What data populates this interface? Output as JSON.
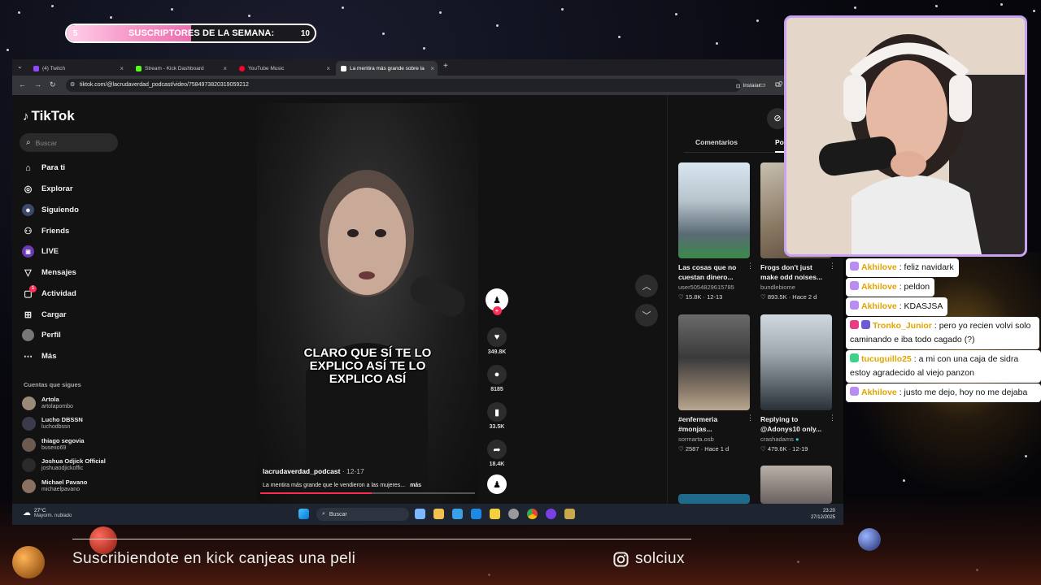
{
  "overlay": {
    "sub_goal": {
      "current": "5",
      "label": "SUSCRIPTORES DE LA SEMANA:",
      "target": "10",
      "progress": 0.5,
      "fill_color": "#f58fc3"
    },
    "footer_text": "Suscribiendote en kick canjeas una peli",
    "instagram_handle": "solciux"
  },
  "browser": {
    "tabs": [
      {
        "label": "(4) Twitch",
        "icon": "twitch-icon",
        "color": "#9146ff"
      },
      {
        "label": "Stream - Kick Dashboard",
        "icon": "kick-icon",
        "color": "#53fc18"
      },
      {
        "label": "YouTube Music",
        "icon": "youtube-music-icon",
        "color": "#ff0033"
      },
      {
        "label": "La mentira más grande sobre la",
        "icon": "tiktok-icon",
        "color": "#ffffff",
        "active": true
      }
    ],
    "url": "tiktok.com/@lacrudaverdad_podcast/video/7584973820319059212",
    "install_label": "Instalar"
  },
  "tiktok": {
    "logo": "TikTok",
    "search_placeholder": "Buscar",
    "nav": [
      {
        "label": "Para ti",
        "icon": "home-icon"
      },
      {
        "label": "Explorar",
        "icon": "compass-icon"
      },
      {
        "label": "Siguiendo",
        "icon": "following-icon"
      },
      {
        "label": "Friends",
        "icon": "friends-icon"
      },
      {
        "label": "LIVE",
        "icon": "live-icon"
      },
      {
        "label": "Mensajes",
        "icon": "messages-icon"
      },
      {
        "label": "Actividad",
        "icon": "activity-icon",
        "badge": "1"
      },
      {
        "label": "Cargar",
        "icon": "upload-icon"
      },
      {
        "label": "Perfil",
        "icon": "profile-icon"
      },
      {
        "label": "Más",
        "icon": "more-icon"
      }
    ],
    "following_heading": "Cuentas que sigues",
    "following": [
      {
        "name": "Artola",
        "handle": "artolapombo"
      },
      {
        "name": "Lucho DBSSN",
        "handle": "luchodbssn"
      },
      {
        "name": "thiago segovia",
        "handle": "busexo69"
      },
      {
        "name": "Joshua Odjick Official",
        "handle": "joshuaodjickoffic"
      },
      {
        "name": "Michael Pavano",
        "handle": "michaelpavano"
      }
    ],
    "video": {
      "caption": "CLARO QUE SÍ TE LO EXPLICO ASÍ TE LO EXPLICO ASÍ",
      "author": "lacrudaverdad_podcast",
      "date": "· 12-17",
      "description": "La mentira más grande que le vendieron a las mujeres...",
      "more": "más",
      "progress": 0.52,
      "likes": "349.8K",
      "comments": "8185",
      "saves": "33.5K",
      "shares": "18.4K"
    },
    "side_tabs": [
      "Comentarios",
      "Podría"
    ],
    "recommended": [
      {
        "title": "Las cosas que no cuestan dinero...",
        "user": "user5054829615785",
        "views": "15.8K",
        "date": "12-13"
      },
      {
        "title": "Frogs don't just make odd noises...",
        "user": "bundlebiome",
        "views": "893.5K",
        "date": "Hace 2 d"
      },
      {
        "title": "#enfermeria #monjas...",
        "user": "sormarta.osb",
        "views": "2587",
        "date": "Hace 1 d"
      },
      {
        "title": "Replying to @Adonys10 only...",
        "user": "crashadams",
        "views": "479.6K",
        "date": "12-19",
        "verified": true
      }
    ]
  },
  "taskbar": {
    "weather_temp": "27°C",
    "weather_desc": "Mayorm. nublado",
    "search_label": "Buscar",
    "time": "23:20",
    "date": "27/12/2025"
  },
  "chat": [
    {
      "user": "Akhilove",
      "text": ": feliz navidark",
      "color": "#e0a400",
      "badge_color": "#b98cf0"
    },
    {
      "user": "Akhilove",
      "text": ": peldon",
      "color": "#e0a400",
      "badge_color": "#b98cf0"
    },
    {
      "user": "Akhilove",
      "text": ": KDASJSA",
      "color": "#e0a400",
      "badge_color": "#b98cf0"
    },
    {
      "user": "Tronko_Junior",
      "text": ": pero yo recien volvi solo caminando e iba todo cagado (?)",
      "color": "#e0a400",
      "badge_color": "#e83d84"
    },
    {
      "user": "tucuguillo25",
      "text": ": a mi con una caja de sidra estoy agradecido al viejo panzon",
      "color": "#e0a400",
      "badge_color": "#3fd18a"
    },
    {
      "user": "Akhilove",
      "text": ": justo me dejo, hoy no me dejaba",
      "color": "#e0a400",
      "badge_color": "#b98cf0"
    }
  ]
}
